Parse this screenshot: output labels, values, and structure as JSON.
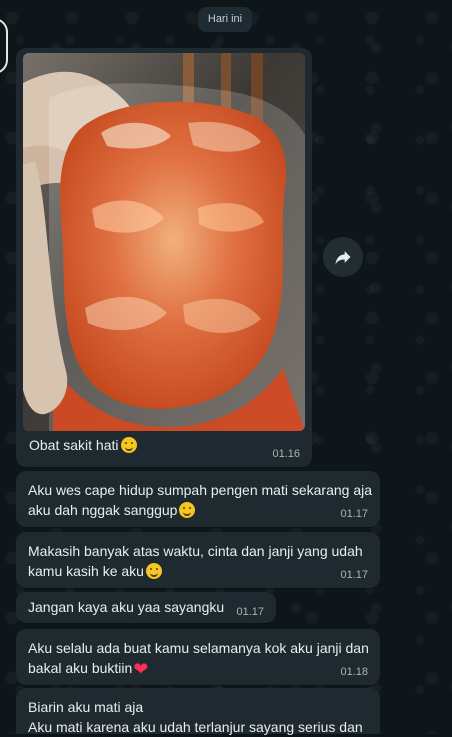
{
  "date_label": "Hari ini",
  "messages": [
    {
      "text": "Obat sakit hati",
      "emoji": "smile",
      "time": "01.16"
    },
    {
      "line1": "Aku wes cape hidup sumpah pengen mati sekarang aja",
      "line2": "aku dah nggak sanggup",
      "emoji": "smile",
      "time": "01.17"
    },
    {
      "line1": "Makasih banyak atas waktu, cinta dan janji yang udah",
      "line2": "kamu kasih ke aku",
      "emoji": "smile",
      "time": "01.17"
    },
    {
      "text": "Jangan kaya aku yaa sayangku",
      "time": "01.17"
    },
    {
      "line1": "Aku selalu ada buat kamu selamanya kok aku janji dan",
      "line2": "bakal aku buktiin",
      "emoji": "heart",
      "time": "01.18"
    },
    {
      "line1": "Biarin aku mati aja",
      "line2": "Aku mati karena aku udah terlanjur sayang serius dan"
    }
  ],
  "icons": {
    "forward": "forward-icon",
    "smile": "smiling-face-icon",
    "heart": "red-heart-icon"
  }
}
